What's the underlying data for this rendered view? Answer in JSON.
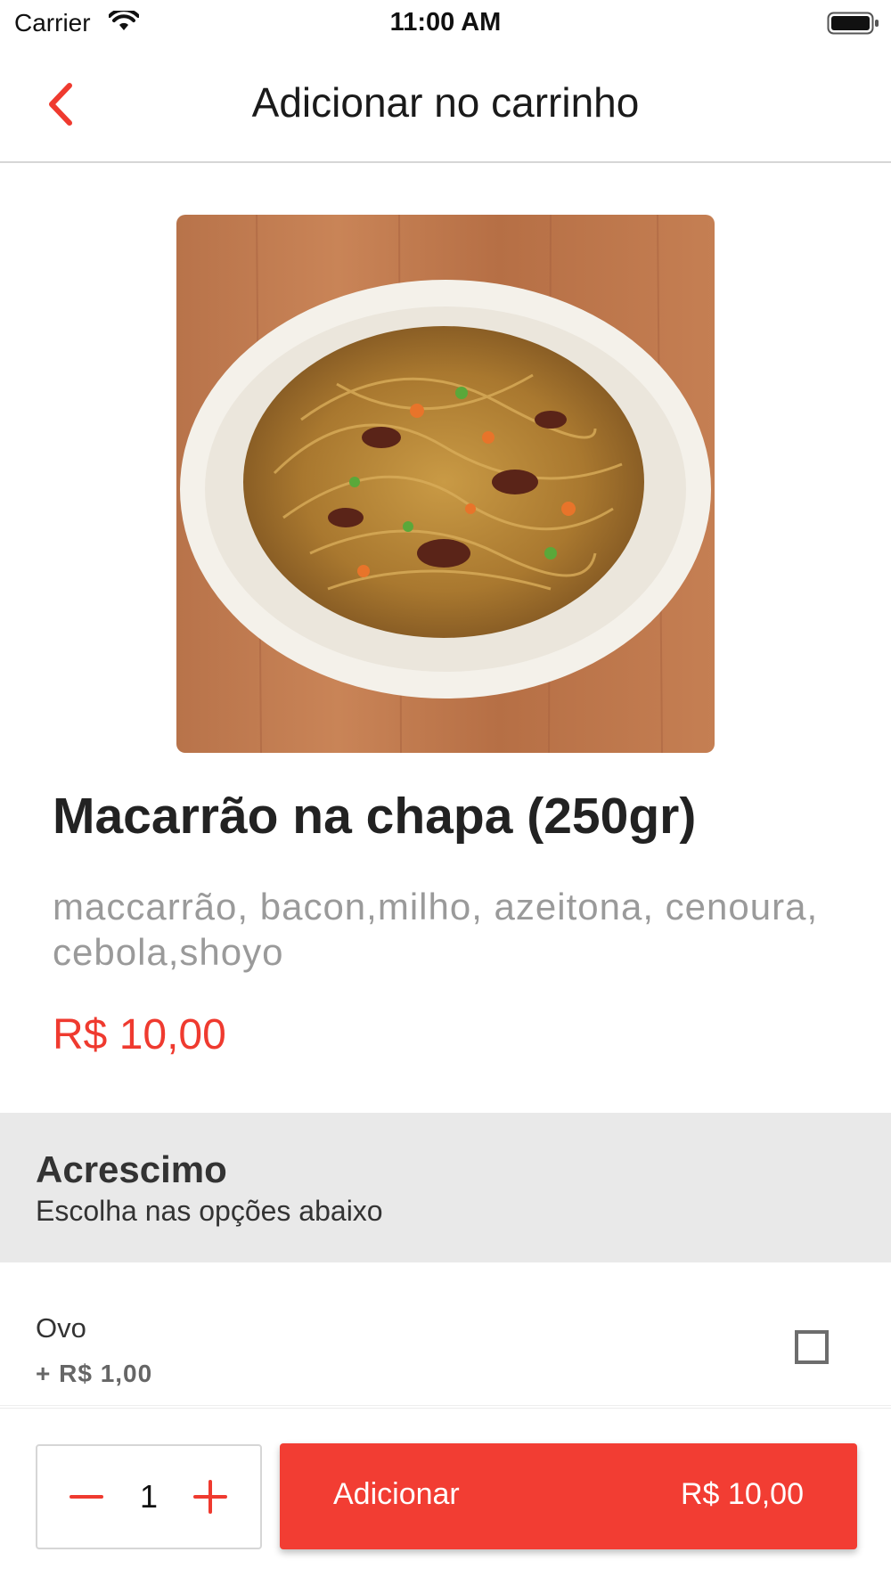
{
  "status_bar": {
    "carrier": "Carrier",
    "time": "11:00 AM"
  },
  "nav": {
    "title": "Adicionar no carrinho"
  },
  "product": {
    "name": "Macarrão na chapa (250gr)",
    "description": "maccarrão, bacon,milho, azeitona, cenoura, cebola,shoyo",
    "price": "R$ 10,00"
  },
  "extras": {
    "title": "Acrescimo",
    "subtitle": "Escolha nas opções abaixo",
    "options": [
      {
        "name": "Ovo",
        "price": "+ R$ 1,00",
        "checked": false
      }
    ]
  },
  "footer": {
    "quantity": "1",
    "add_label": "Adicionar",
    "add_price": "R$ 10,00"
  },
  "colors": {
    "accent": "#f23d33",
    "price_text": "#ef3a2f"
  }
}
